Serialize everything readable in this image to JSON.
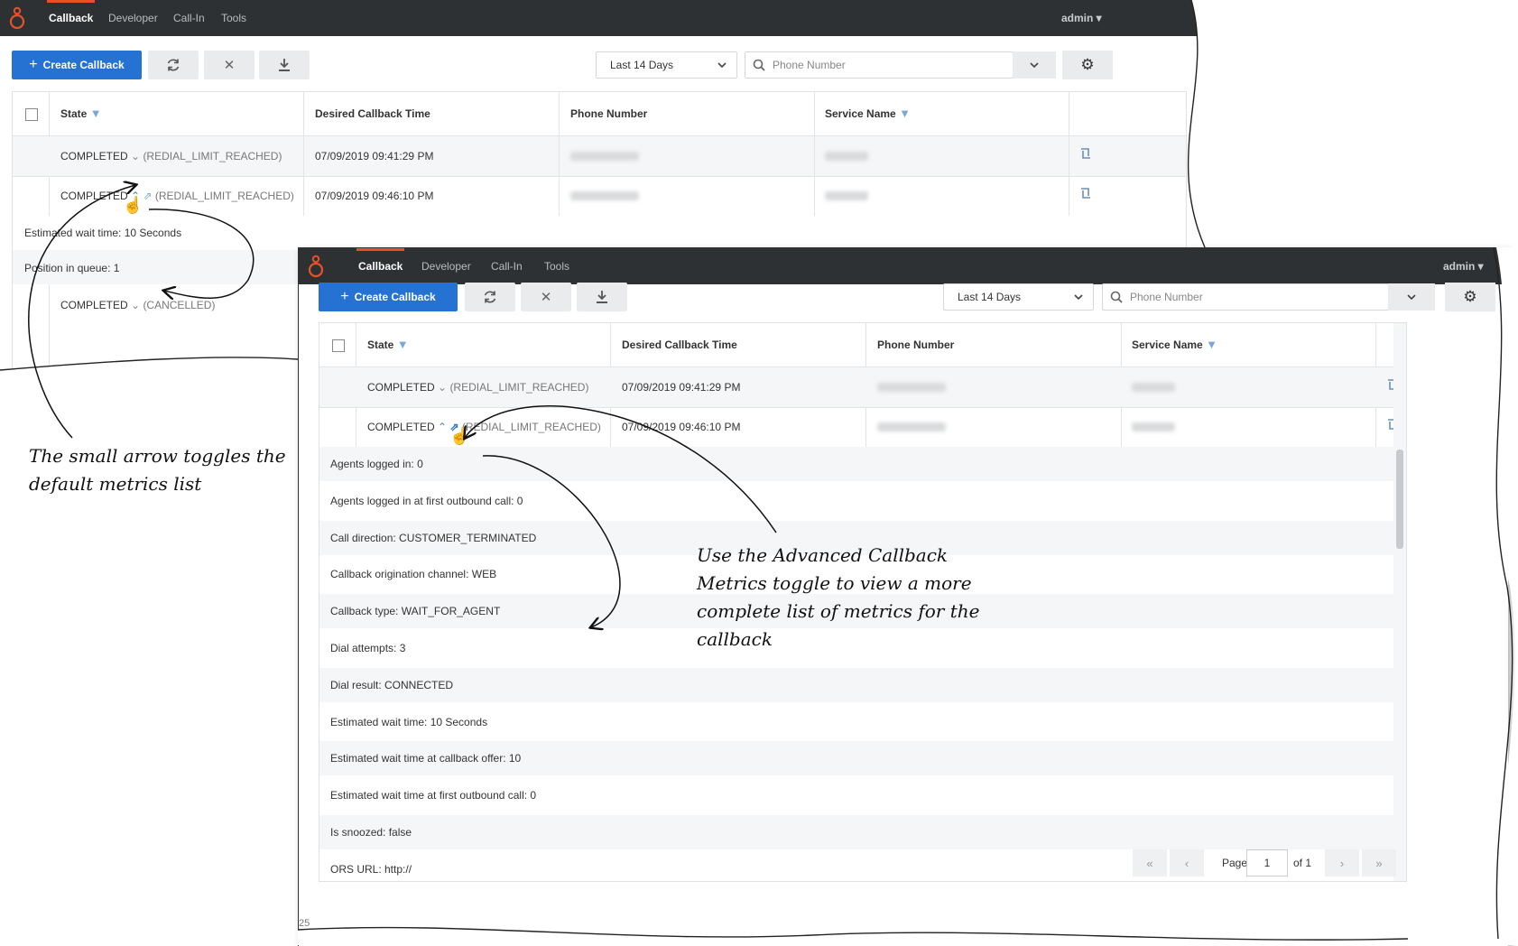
{
  "app": {
    "nav": [
      "Callback",
      "Developer",
      "Call-In",
      "Tools"
    ],
    "user": "admin ▾"
  },
  "toolbar": {
    "create_label": "Create Callback",
    "date_range": "Last 14 Days",
    "phone_placeholder": "Phone Number"
  },
  "table": {
    "columns": [
      "State",
      "Desired Callback Time",
      "Phone Number",
      "Service Name"
    ]
  },
  "shot1": {
    "rows": [
      {
        "state": "COMPLETED",
        "reason": "(REDIAL_LIMIT_REACHED)",
        "time": "07/09/2019 09:41:29 PM"
      },
      {
        "state": "COMPLETED",
        "reason": "(REDIAL_LIMIT_REACHED)",
        "time": "07/09/2019 09:46:10 PM"
      }
    ],
    "metrics": [
      "Estimated wait time: 10 Seconds",
      "Position in queue: 1"
    ],
    "row3": {
      "state": "COMPLETED",
      "reason": "(CANCELLED)"
    }
  },
  "shot2": {
    "rows": [
      {
        "state": "COMPLETED",
        "reason": "(REDIAL_LIMIT_REACHED)",
        "time": "07/09/2019 09:41:29 PM"
      },
      {
        "state": "COMPLETED",
        "reason": "(REDIAL_LIMIT_REACHED)",
        "time": "07/09/2019 09:46:10 PM"
      }
    ],
    "metrics": [
      "Agents logged in: 0",
      "Agents logged in at first outbound call: 0",
      "Call direction: CUSTOMER_TERMINATED",
      "Callback origination channel: WEB",
      "Callback type: WAIT_FOR_AGENT",
      "Dial attempts: 3",
      "Dial result: CONNECTED",
      "Estimated wait time: 10 Seconds",
      "Estimated wait time at callback offer: 10",
      "Estimated wait time at first outbound call: 0",
      "Is snoozed: false",
      "ORS URL: http://"
    ]
  },
  "pager": {
    "page_label": "Page",
    "page_value": "1",
    "of_label": "of 1",
    "footer_partial": "25"
  },
  "annotations": {
    "left": [
      "The small arrow toggles the",
      "default metrics list"
    ],
    "right": [
      "Use the Advanced Callback",
      "Metrics toggle to view a more",
      "complete list of metrics for the",
      "callback"
    ]
  },
  "colors": {
    "topbar": "#2e3133",
    "accent": "#e8502a",
    "primary": "#2572d2"
  }
}
